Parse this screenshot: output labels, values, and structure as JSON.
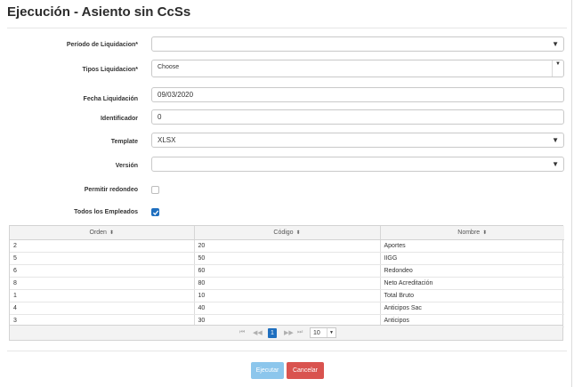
{
  "page": {
    "title": "Ejecución - Asiento sin CcSs"
  },
  "form": {
    "periodo": {
      "label": "Período de Liquidacion*",
      "value": ""
    },
    "tipos": {
      "label": "Tipos Liquidacion*",
      "value": "Choose"
    },
    "fecha": {
      "label": "Fecha Liquidación",
      "value": "09/03/2020"
    },
    "identificador": {
      "label": "Identificador",
      "value": "0"
    },
    "template": {
      "label": "Template",
      "value": "XLSX"
    },
    "version": {
      "label": "Versión",
      "value": ""
    },
    "redondeo": {
      "label": "Permitir redondeo",
      "checked": false
    },
    "empleados": {
      "label": "Todos los Empleados",
      "checked": true
    }
  },
  "grid": {
    "columns": [
      "Orden",
      "Código",
      "Nombre"
    ],
    "rows": [
      [
        "2",
        "20",
        "Aportes"
      ],
      [
        "5",
        "50",
        "IIGG"
      ],
      [
        "6",
        "60",
        "Redondeo"
      ],
      [
        "8",
        "80",
        "Neto Acreditación"
      ],
      [
        "1",
        "10",
        "Total Bruto"
      ],
      [
        "4",
        "40",
        "Anticipos Sac"
      ],
      [
        "3",
        "30",
        "Anticipos"
      ]
    ],
    "pager": {
      "current_page": "1",
      "page_size": "10"
    }
  },
  "buttons": {
    "execute": "Ejecutar",
    "cancel": "Cancelar"
  },
  "colors": {
    "primary": "#1f6fbf",
    "execute_bg": "#8cc6ec",
    "cancel_bg": "#d9534f"
  },
  "icons": {
    "sort": "sort-icon",
    "dropdown": "caret-down-icon",
    "check": "check-icon",
    "first": "first-page-icon",
    "prev": "prev-page-icon",
    "next": "next-page-icon",
    "last": "last-page-icon"
  }
}
